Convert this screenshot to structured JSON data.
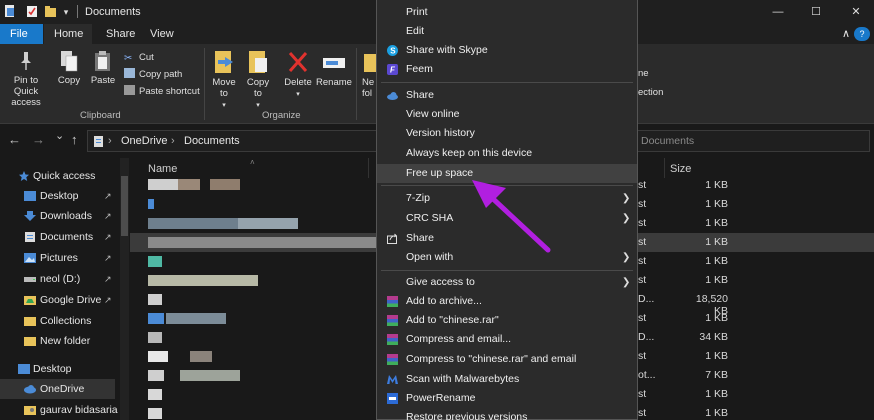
{
  "titlebar": {
    "title": "Documents",
    "qat_more": "▾",
    "minimize": "—",
    "maximize": "☐",
    "close": "✕"
  },
  "tabs": {
    "file": "File",
    "home": "Home",
    "share": "Share",
    "view": "View",
    "collapse": "∧",
    "help": "?"
  },
  "ribbon": {
    "pin_to_quick_access": "Pin to Quick access",
    "copy": "Copy",
    "paste": "Paste",
    "cut": "Cut",
    "copy_path": "Copy path",
    "paste_shortcut": "Paste shortcut",
    "clipboard_group": "Clipboard",
    "move_to": "Move to",
    "copy_to": "Copy to",
    "delete": "Delete",
    "rename": "Rename",
    "organize_group": "Organize",
    "new_folder_partial": "Ne fol",
    "select_none_partial": "ne",
    "invert_selection_partial": "ection"
  },
  "address": {
    "back": "←",
    "forward": "→",
    "recent": "⌄",
    "up": "↑",
    "crumbs": [
      "OneDrive",
      "Documents"
    ],
    "search_placeholder": "Documents"
  },
  "sidebar": {
    "items": [
      {
        "label": "Quick access",
        "icon": "star-icon"
      },
      {
        "label": "Desktop",
        "icon": "desktop-folder-icon",
        "pinned": true
      },
      {
        "label": "Downloads",
        "icon": "downloads-icon",
        "pinned": true
      },
      {
        "label": "Documents",
        "icon": "documents-icon",
        "pinned": true
      },
      {
        "label": "Pictures",
        "icon": "pictures-icon",
        "pinned": true
      },
      {
        "label": "neol (D:)",
        "icon": "drive-icon",
        "pinned": true
      },
      {
        "label": "Google Drive",
        "icon": "google-drive-icon",
        "pinned": true
      },
      {
        "label": "Collections",
        "icon": "folder-icon"
      },
      {
        "label": "New folder",
        "icon": "folder-icon"
      },
      {
        "label": "Desktop",
        "icon": "desktop-folder-icon"
      },
      {
        "label": "OneDrive",
        "icon": "onedrive-icon"
      },
      {
        "label": "gaurav bidasaria",
        "icon": "user-folder-icon"
      }
    ],
    "pin_glyph": "↗"
  },
  "filelist": {
    "col_name": "Name",
    "col_size": "Size",
    "sort_indicator": "˄",
    "rows": [
      {
        "date": "st",
        "size": "1 KB"
      },
      {
        "date": "st",
        "size": "1 KB"
      },
      {
        "date": "st",
        "size": "1 KB"
      },
      {
        "date": "st",
        "size": "1 KB",
        "selected": true
      },
      {
        "date": "st",
        "size": "1 KB"
      },
      {
        "date": "st",
        "size": "1 KB"
      },
      {
        "date": "D...",
        "size": "18,520 KB"
      },
      {
        "date": "st",
        "size": "1 KB"
      },
      {
        "date": "D...",
        "size": "34 KB"
      },
      {
        "date": "st",
        "size": "1 KB"
      },
      {
        "date": "ot...",
        "size": "7 KB"
      },
      {
        "date": "st",
        "size": "1 KB"
      },
      {
        "date": "st",
        "size": "1 KB"
      }
    ]
  },
  "context_menu": {
    "items": [
      {
        "label": "Print"
      },
      {
        "label": "Edit"
      },
      {
        "label": "Share with Skype",
        "icon": "skype-icon"
      },
      {
        "label": "Feem",
        "icon": "feem-icon"
      },
      {
        "label": "Share",
        "icon": "onedrive-cloud-icon"
      },
      {
        "label": "View online"
      },
      {
        "label": "Version history"
      },
      {
        "label": "Always keep on this device"
      },
      {
        "label": "Free up space",
        "highlighted": true
      },
      {
        "label": "7-Zip",
        "submenu": true
      },
      {
        "label": "CRC SHA",
        "submenu": true
      },
      {
        "label": "Share",
        "icon": "share-icon"
      },
      {
        "label": "Open with",
        "submenu": true
      },
      {
        "label": "Give access to",
        "submenu": true
      },
      {
        "label": "Add to archive...",
        "icon": "winrar-icon"
      },
      {
        "label": "Add to \"chinese.rar\"",
        "icon": "winrar-icon"
      },
      {
        "label": "Compress and email...",
        "icon": "winrar-icon"
      },
      {
        "label": "Compress to \"chinese.rar\" and email",
        "icon": "winrar-icon"
      },
      {
        "label": "Scan with Malwarebytes",
        "icon": "malwarebytes-icon"
      },
      {
        "label": "PowerRename",
        "icon": "powerrename-icon"
      },
      {
        "label": "Restore previous versions"
      }
    ],
    "submenu_glyph": "❯"
  },
  "colors": {
    "accent": "#1979ca",
    "annotation_arrow": "#b11fe0",
    "menu_bg": "#2b2b2b",
    "window_bg": "#191919"
  }
}
